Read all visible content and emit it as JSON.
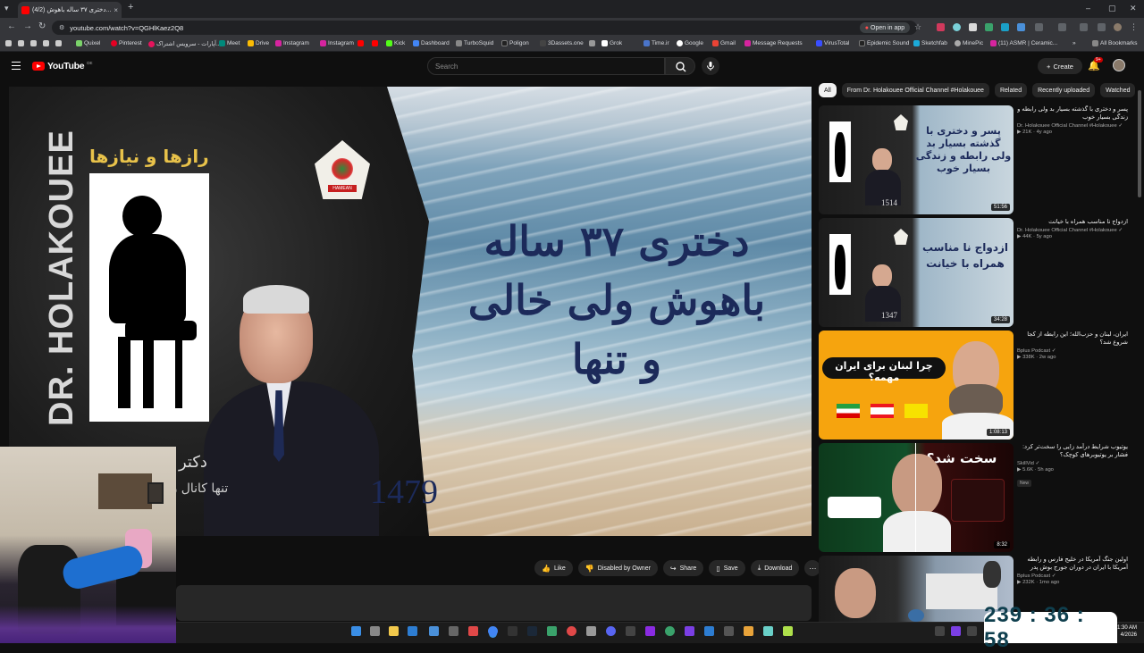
{
  "browser": {
    "tab_title": "(4/2) دختری ۳۷ ساله باهوش...",
    "url": "youtube.com/watch?v=QGHlKaez2Q8",
    "open_in_app": "Open in app",
    "all_bookmarks": "All Bookmarks",
    "bookmarks": [
      "Quixel",
      "Pinterest",
      "آپارات - سرویس اشتراک...",
      "Meet",
      "Drive",
      "Instagram",
      "Instagram",
      "Kick",
      "Dashboard",
      "TurboSquid",
      "Poligon",
      "3Dassets.one",
      "Grok",
      "Time.ir",
      "Google",
      "Gmail",
      "Message Requests",
      "VirusTotal",
      "Epidemic Sound",
      "Sketchfab",
      "MinePic",
      "(11) ASMR | Ceramic..."
    ]
  },
  "youtube": {
    "logo": "YouTube",
    "country_code": "DE",
    "search_placeholder": "Search",
    "create_label": "Create",
    "notif_count": "9+"
  },
  "video": {
    "title_lines": [
      "دختری ۳۷ ساله",
      "باهوش ولی خالی",
      "و تنها"
    ],
    "number": "1479",
    "tagline": "رازها و نیازها",
    "doctor": "DR. HOLAKOUEE",
    "badge_label": "HAMEAN",
    "subtitle1": "دکتر",
    "subtitle2": "تنها کانال رسمی"
  },
  "actions": {
    "like": "Like",
    "dislike": "Disabled by Owner",
    "share": "Share",
    "save": "Save",
    "download": "Download"
  },
  "chips": [
    "All",
    "From Dr. Holakouee Official Channel #Holakouee",
    "Related",
    "Recently uploaded",
    "Watched"
  ],
  "recommendations": [
    {
      "title": "پسر و دختری با گذشته بسیار بد ولی رابطه و زندگی بسیار خوب",
      "channel": "Dr. Holakouee Official Channel #Holakouee",
      "views": "21K",
      "age": "4y ago",
      "duration": "51:56",
      "thumb_text": "پسر و دختری با گذشته بسیار بد ولی رابطه و زندگی بسیار خوب",
      "thumb_number": "1514"
    },
    {
      "title": "ازدواج نا مناسب همراه با خیانت",
      "channel": "Dr. Holakouee Official Channel #Holakouee",
      "views": "44K",
      "age": "5y ago",
      "duration": "34:28",
      "thumb_text": "ازدواج نا مناسب همراه با خیانت",
      "thumb_number": "1347"
    },
    {
      "title": "ایران، لبنان و حزب‌الله؛ این رابطه از کجا شروع شد؟",
      "channel": "Bplus Podcast",
      "views": "338K",
      "age": "2w ago",
      "duration": "1:08:13",
      "thumb_text": "چرا لبنان برای ایران مهمه؟"
    },
    {
      "title": "یوتیوب شرایط درآمد زایی را سخت‌تر کرد: فشار بر یوتیوبرهای کوچک؟",
      "channel": "SkillVid",
      "views": "5.6K",
      "age": "5h ago",
      "duration": "8:32",
      "badge": "New",
      "thumb_text": "سخت شد؟"
    },
    {
      "title": "اولین جنگ آمریکا در خلیج فارس و رابطه آمریکا با ایران در دوران جورج بوش پدر",
      "channel": "Bplus Podcast",
      "views": "232K",
      "age": "1mo ago"
    }
  ],
  "taskbar": {
    "time": "1:30 AM",
    "date": "4/2026"
  },
  "timer": "239 : 36 : 58",
  "colors": {
    "yt_red": "#ff0000",
    "bg": "#0f0f0f",
    "chip_bg": "#272727",
    "title_navy": "#1c2a5a",
    "timer_text": "#0f3f4e"
  }
}
